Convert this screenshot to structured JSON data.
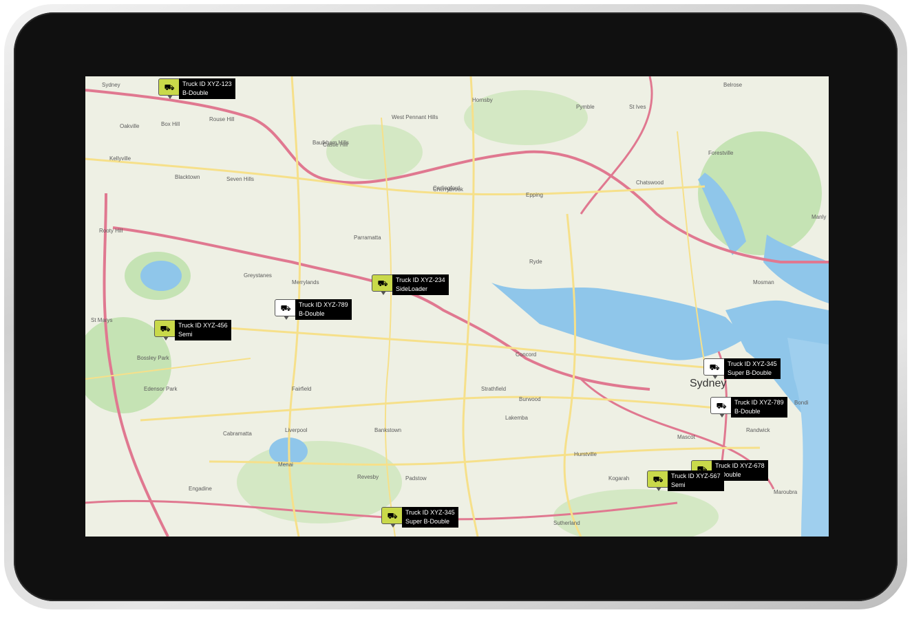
{
  "map": {
    "places": [
      {
        "id": "sydney",
        "name": "Sydney"
      },
      {
        "id": "oakville",
        "name": "Oakville"
      },
      {
        "id": "box-hill",
        "name": "Box Hill"
      },
      {
        "id": "kellyville",
        "name": "Kellyville"
      },
      {
        "id": "rouse-hill",
        "name": "Rouse Hill"
      },
      {
        "id": "castle-hill",
        "name": "Castle Hill"
      },
      {
        "id": "west-pennant-hills",
        "name": "West Pennant Hills"
      },
      {
        "id": "cherrybrook",
        "name": "Cherrybrook"
      },
      {
        "id": "hornsby",
        "name": "Hornsby"
      },
      {
        "id": "pymble",
        "name": "Pymble"
      },
      {
        "id": "st-ives",
        "name": "St Ives"
      },
      {
        "id": "belrose",
        "name": "Belrose"
      },
      {
        "id": "forestville",
        "name": "Forestville"
      },
      {
        "id": "blacktown",
        "name": "Blacktown"
      },
      {
        "id": "seven-hills",
        "name": "Seven Hills"
      },
      {
        "id": "baulkham-hills",
        "name": "Baulkham Hills"
      },
      {
        "id": "carlingford",
        "name": "Carlingford"
      },
      {
        "id": "epping",
        "name": "Epping"
      },
      {
        "id": "chatswood",
        "name": "Chatswood"
      },
      {
        "id": "mosman",
        "name": "Mosman"
      },
      {
        "id": "manly",
        "name": "Manly"
      },
      {
        "id": "parramatta",
        "name": "Parramatta"
      },
      {
        "id": "merrylands",
        "name": "Merrylands"
      },
      {
        "id": "greystanes",
        "name": "Greystanes"
      },
      {
        "id": "ryde",
        "name": "Ryde"
      },
      {
        "id": "concord",
        "name": "Concord"
      },
      {
        "id": "strathfield",
        "name": "Strathfield"
      },
      {
        "id": "burwood",
        "name": "Burwood"
      },
      {
        "id": "fairfield",
        "name": "Fairfield"
      },
      {
        "id": "cabramatta",
        "name": "Cabramatta"
      },
      {
        "id": "liverpool",
        "name": "Liverpool"
      },
      {
        "id": "bankstown",
        "name": "Bankstown"
      },
      {
        "id": "lakemba",
        "name": "Lakemba"
      },
      {
        "id": "hurstville",
        "name": "Hurstville"
      },
      {
        "id": "kogarah",
        "name": "Kogarah"
      },
      {
        "id": "randwick",
        "name": "Randwick"
      },
      {
        "id": "maroubra",
        "name": "Maroubra"
      },
      {
        "id": "bondi",
        "name": "Bondi"
      },
      {
        "id": "mascot",
        "name": "Mascot"
      },
      {
        "id": "penrith",
        "name": "St Marys"
      },
      {
        "id": "rooty-hill",
        "name": "Rooty Hill"
      },
      {
        "id": "bossley-park",
        "name": "Bossley Park"
      },
      {
        "id": "edensor-park",
        "name": "Edensor Park"
      },
      {
        "id": "padstow",
        "name": "Padstow"
      },
      {
        "id": "revesby",
        "name": "Revesby"
      },
      {
        "id": "engadine",
        "name": "Engadine"
      },
      {
        "id": "sutherland",
        "name": "Sutherland"
      },
      {
        "id": "menai",
        "name": "Menai"
      }
    ]
  },
  "trucks": [
    {
      "id": "Truck ID XYZ-123",
      "type": "B-Double",
      "icon": "truck-icon"
    },
    {
      "id": "Truck ID XYZ-234",
      "type": "SideLoader",
      "icon": "truck-icon"
    },
    {
      "id": "Truck ID XYZ-789",
      "type": "B-Double",
      "icon": "truck-icon"
    },
    {
      "id": "Truck ID XYZ-456",
      "type": "Semi",
      "icon": "truck-icon"
    },
    {
      "id": "Truck ID XYZ-345",
      "type": "Super B-Double",
      "icon": "truck-icon"
    },
    {
      "id": "Truck ID XYZ-789",
      "type": "B-Double",
      "icon": "truck-icon"
    },
    {
      "id": "Truck ID XYZ-678",
      "type": "B-Double",
      "icon": "truck-icon"
    },
    {
      "id": "Truck ID XYZ-567",
      "type": "Semi",
      "icon": "truck-icon"
    },
    {
      "id": "Truck ID XYZ-345",
      "type": "Super B-Double",
      "icon": "truck-icon"
    }
  ],
  "colors": {
    "bezel": "#101010",
    "land": "#eef0e4",
    "water": "#8fc6ea",
    "park": "#c5e3b4",
    "highway": "#e07890",
    "road": "#f6e08a",
    "marker_yellow": "#c9d94a"
  }
}
